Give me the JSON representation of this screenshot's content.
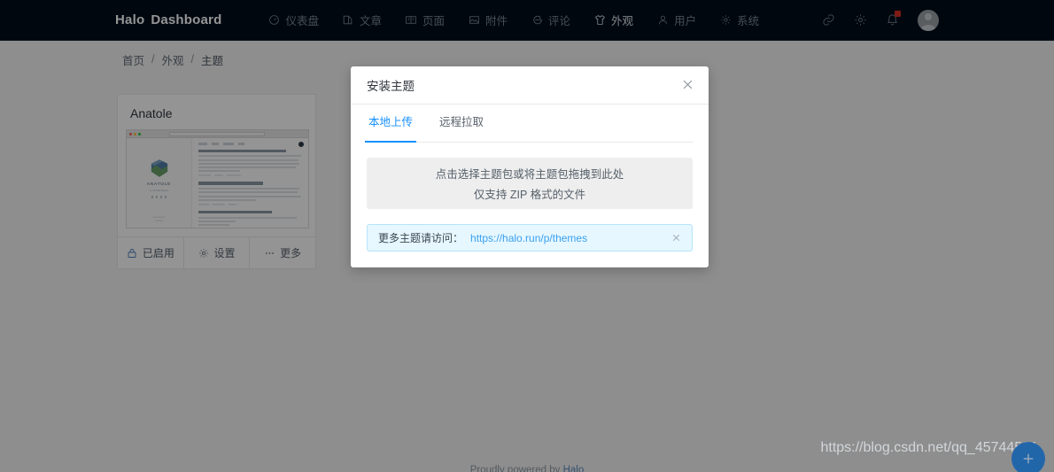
{
  "navbar": {
    "brand_primary": "Halo",
    "brand_secondary": "Dashboard",
    "items": [
      {
        "label": "仪表盘",
        "icon": "dashboard-icon",
        "active": false
      },
      {
        "label": "文章",
        "icon": "edit-icon",
        "active": false
      },
      {
        "label": "页面",
        "icon": "page-icon",
        "active": false
      },
      {
        "label": "附件",
        "icon": "image-icon",
        "active": false
      },
      {
        "label": "评论",
        "icon": "comment-icon",
        "active": false
      },
      {
        "label": "外观",
        "icon": "shirt-icon",
        "active": true
      },
      {
        "label": "用户",
        "icon": "user-icon",
        "active": false
      },
      {
        "label": "系统",
        "icon": "gear-icon",
        "active": false
      }
    ],
    "tools": [
      {
        "name": "link-icon"
      },
      {
        "name": "settings-gear-icon"
      },
      {
        "name": "bell-icon",
        "has_badge": true
      }
    ],
    "avatar_alt": "用户头像"
  },
  "breadcrumb": {
    "items": [
      "首页",
      "外观",
      "主题"
    ],
    "separator": "/"
  },
  "theme_card": {
    "title": "Anatole",
    "preview_logo_text": "ANATOLE",
    "actions": [
      {
        "label": "已启用",
        "icon": "lock-icon"
      },
      {
        "label": "设置",
        "icon": "gear-icon"
      },
      {
        "label": "更多",
        "icon": "ellipsis-icon"
      }
    ]
  },
  "footer": {
    "text": "Proudly powered by ",
    "link": "Halo"
  },
  "modal": {
    "title": "安装主题",
    "close_icon": "close-icon",
    "tabs": [
      {
        "label": "本地上传",
        "active": true
      },
      {
        "label": "远程拉取",
        "active": false
      }
    ],
    "dropzone": {
      "line1": "点击选择主题包或将主题包拖拽到此处",
      "line2": "仅支持 ZIP 格式的文件"
    },
    "alert": {
      "text": "更多主题请访问：",
      "link_text": "https://halo.run/p/themes",
      "close_icon": "close-icon"
    }
  },
  "fab": {
    "icon": "plus-icon"
  },
  "watermark": {
    "text": "https://blog.csdn.net/qq_45744501"
  },
  "colors": {
    "navbar_bg": "#000d1a",
    "accent": "#1890ff",
    "alert_bg": "#e6f7ff",
    "badge": "#d93025",
    "fab": "#2266aa"
  }
}
